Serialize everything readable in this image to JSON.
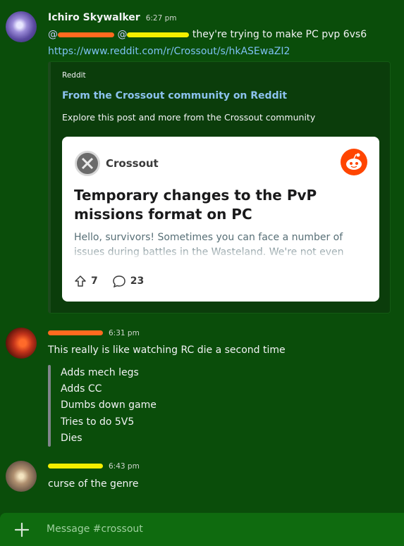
{
  "messages": [
    {
      "username": "Ichiro Skywalker",
      "time": "6:27 pm",
      "mention_prefix": "@",
      "mention2_prefix": "@",
      "text_suffix": "they're trying to make PC pvp 6vs6",
      "link": "https://www.reddit.com/r/Crossout/s/hkASEwaZI2"
    },
    {
      "time": "6:31 pm",
      "text": "This really is like watching RC die a second time",
      "quote_lines": [
        "Adds mech legs",
        "Adds CC",
        "Dumbs down game",
        "Tries to do 5V5",
        "Dies"
      ]
    },
    {
      "time": "6:43 pm",
      "text": "curse of the genre"
    }
  ],
  "embed": {
    "provider": "Reddit",
    "title": "From the Crossout community on Reddit",
    "description": "Explore this post and more from the Crossout community",
    "card": {
      "community": "Crossout",
      "post_title": "Temporary changes to the PvP missions format on PC",
      "post_body": "Hello, survivors! Sometimes you can face a number of issues during battles in the Wasteland. We're not even",
      "upvotes": "7",
      "comments": "23"
    }
  },
  "composer": {
    "placeholder": "Message #crossout"
  },
  "colors": {
    "background": "#0a4d0a",
    "link": "#7ec1f3",
    "embed_title": "#8cc2ee",
    "reddit": "#ff4500",
    "redaction_orange": "#ff6a1f",
    "redaction_yellow": "#f4ee00"
  }
}
